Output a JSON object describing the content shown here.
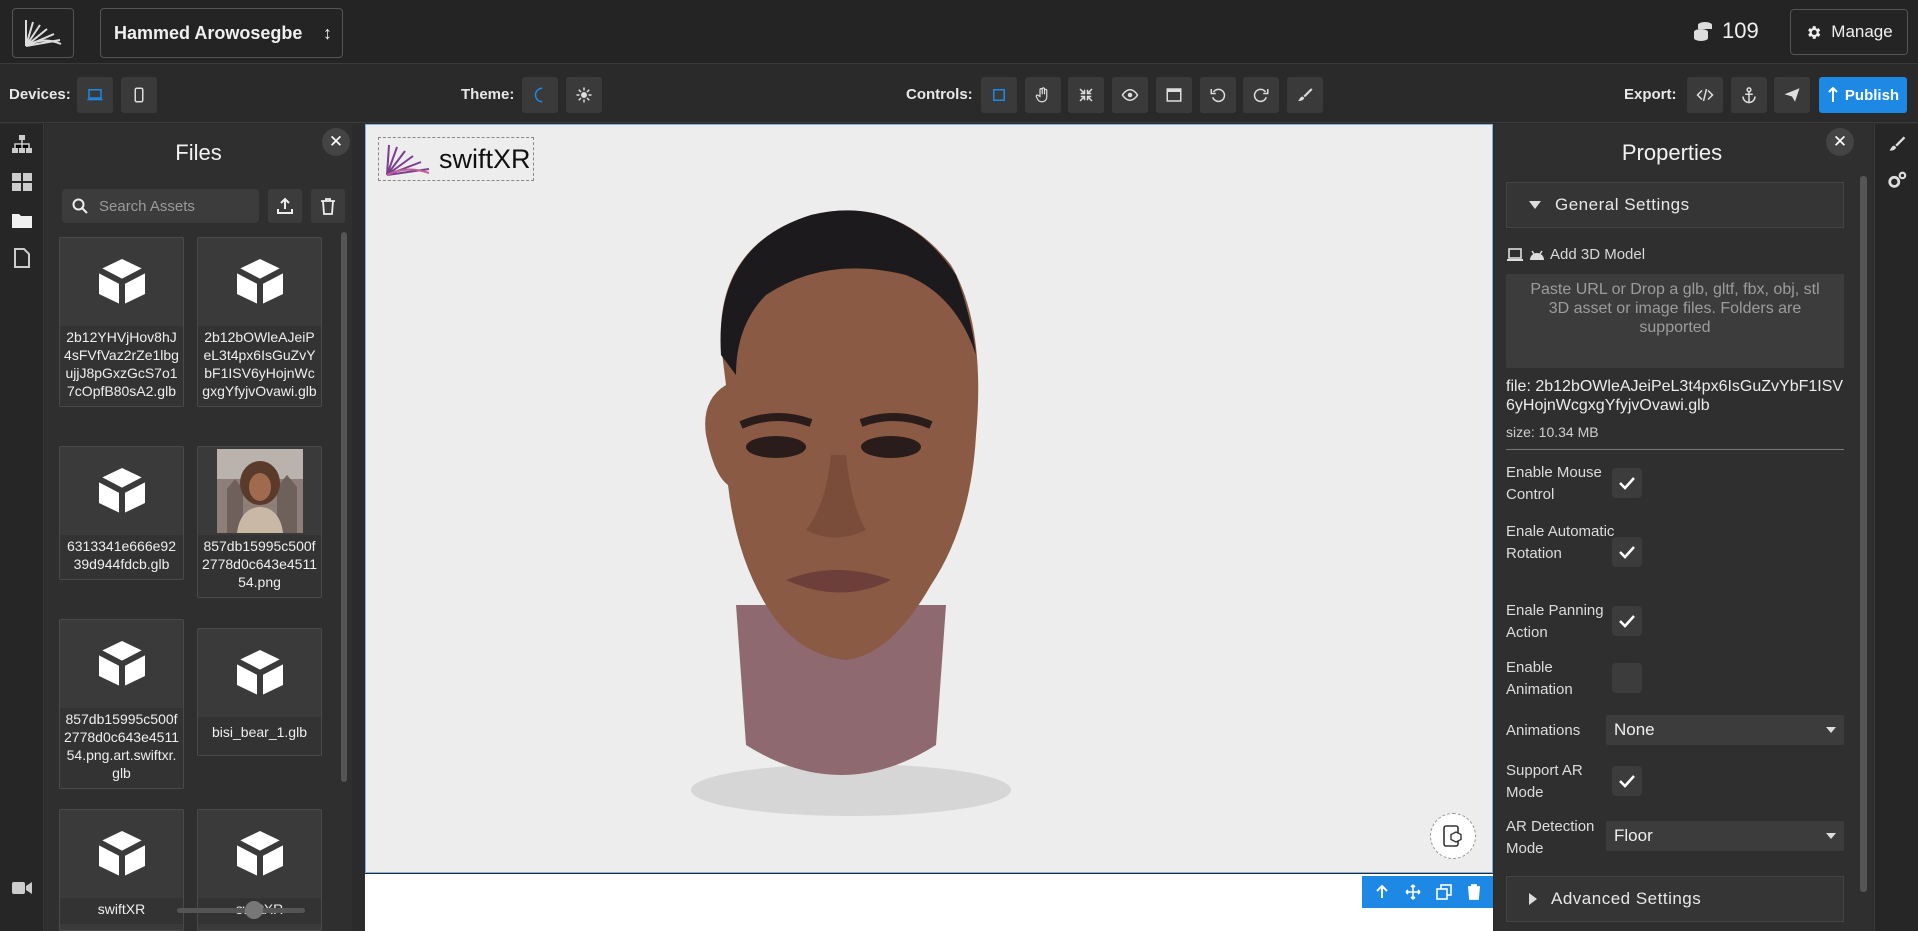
{
  "header": {
    "user_name": "Hammed Arowosegbe",
    "credits": "109",
    "manage_label": "Manage"
  },
  "toolbar": {
    "devices_label": "Devices:",
    "theme_label": "Theme:",
    "controls_label": "Controls:",
    "export_label": "Export:",
    "publish_label": "Publish"
  },
  "files": {
    "title": "Files",
    "search_placeholder": "Search Assets",
    "items": [
      {
        "name": "2b12YHVjHov8hJ4sFVfVaz2rZe1lbgujjJ8pGxzGcS7o17cOpfB80sA2.glb",
        "type": "model"
      },
      {
        "name": "2b12bOWleAJeiPeL3t4px6IsGuZvYbF1ISV6yHojnWcgxgYfyjvOvawi.glb",
        "type": "model"
      },
      {
        "name": "6313341e666e9239d944fdcb.glb",
        "type": "model"
      },
      {
        "name": "857db15995c500f2778d0c643e451154.png",
        "type": "image"
      },
      {
        "name": "857db15995c500f2778d0c643e451154.png.art.swiftxr.glb",
        "type": "model"
      },
      {
        "name": "bisi_bear_1.glb",
        "type": "model"
      },
      {
        "name": "swiftXR",
        "type": "model"
      },
      {
        "name": "swiftXR",
        "type": "model"
      }
    ]
  },
  "viewport": {
    "brand_text": "swiftXR"
  },
  "properties": {
    "title": "Properties",
    "general_settings": "General Settings",
    "add_model_label": "Add 3D Model",
    "dropzone_text": "Paste URL or Drop a glb, gltf, fbx, obj, stl 3D asset or image files. Folders are supported",
    "file_line": "file: 2b12bOWleAJeiPeL3t4px6IsGuZvYbF1ISV6yHojnWcgxgYfyjvOvawi.glb",
    "size_line": "size: 10.34 MB",
    "enable_mouse_control": {
      "label": "Enable Mouse Control",
      "checked": true
    },
    "automatic_rotation": {
      "label": "Enale Automatic Rotation",
      "checked": true
    },
    "panning_action": {
      "label": "Enale Panning Action",
      "checked": true
    },
    "enable_animation": {
      "label": "Enable Animation",
      "checked": false
    },
    "animations": {
      "label": "Animations",
      "value": "None"
    },
    "support_ar": {
      "label": "Support AR Mode",
      "checked": true
    },
    "ar_detection": {
      "label": "AR Detection Mode",
      "value": "Floor"
    },
    "advanced_settings": "Advanced Settings"
  },
  "colors": {
    "accent": "#1e88e5",
    "background": "#2b2b2b",
    "panel": "#2f2f2f",
    "viewport": "#ededed"
  }
}
